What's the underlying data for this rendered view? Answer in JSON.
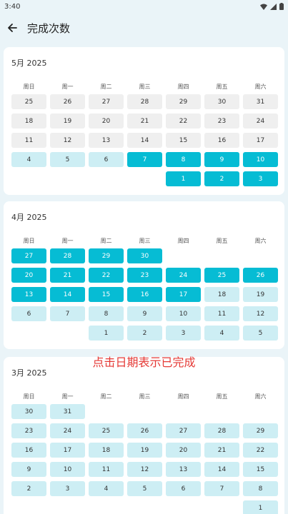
{
  "status": {
    "time": "3:40"
  },
  "app_bar": {
    "title": "完成次数"
  },
  "weekdays": [
    "周日",
    "周一",
    "周二",
    "周三",
    "周四",
    "周五",
    "周六"
  ],
  "months": [
    {
      "title": "5月 2025",
      "rows": [
        [
          {
            "d": "25",
            "s": "past"
          },
          {
            "d": "26",
            "s": "past"
          },
          {
            "d": "27",
            "s": "past"
          },
          {
            "d": "28",
            "s": "past"
          },
          {
            "d": "29",
            "s": "past"
          },
          {
            "d": "30",
            "s": "past"
          },
          {
            "d": "31",
            "s": "past"
          }
        ],
        [
          {
            "d": "18",
            "s": "past"
          },
          {
            "d": "19",
            "s": "past"
          },
          {
            "d": "20",
            "s": "past"
          },
          {
            "d": "21",
            "s": "past"
          },
          {
            "d": "22",
            "s": "past"
          },
          {
            "d": "23",
            "s": "past"
          },
          {
            "d": "24",
            "s": "past"
          }
        ],
        [
          {
            "d": "11",
            "s": "past"
          },
          {
            "d": "12",
            "s": "past"
          },
          {
            "d": "13",
            "s": "past"
          },
          {
            "d": "14",
            "s": "past"
          },
          {
            "d": "15",
            "s": "past"
          },
          {
            "d": "16",
            "s": "past"
          },
          {
            "d": "17",
            "s": "past"
          }
        ],
        [
          {
            "d": "4",
            "s": "future"
          },
          {
            "d": "5",
            "s": "future"
          },
          {
            "d": "6",
            "s": "future"
          },
          {
            "d": "7",
            "s": "done"
          },
          {
            "d": "8",
            "s": "done"
          },
          {
            "d": "9",
            "s": "done"
          },
          {
            "d": "10",
            "s": "done"
          }
        ],
        [
          null,
          null,
          null,
          null,
          {
            "d": "1",
            "s": "done"
          },
          {
            "d": "2",
            "s": "done"
          },
          {
            "d": "3",
            "s": "done"
          }
        ]
      ]
    },
    {
      "title": "4月 2025",
      "rows": [
        [
          {
            "d": "27",
            "s": "done"
          },
          {
            "d": "28",
            "s": "done"
          },
          {
            "d": "29",
            "s": "done"
          },
          {
            "d": "30",
            "s": "done"
          },
          null,
          null,
          null
        ],
        [
          {
            "d": "20",
            "s": "done"
          },
          {
            "d": "21",
            "s": "done"
          },
          {
            "d": "22",
            "s": "done"
          },
          {
            "d": "23",
            "s": "done"
          },
          {
            "d": "24",
            "s": "done"
          },
          {
            "d": "25",
            "s": "done"
          },
          {
            "d": "26",
            "s": "done"
          }
        ],
        [
          {
            "d": "13",
            "s": "done"
          },
          {
            "d": "14",
            "s": "done"
          },
          {
            "d": "15",
            "s": "done"
          },
          {
            "d": "16",
            "s": "done"
          },
          {
            "d": "17",
            "s": "done"
          },
          {
            "d": "18",
            "s": "future"
          },
          {
            "d": "19",
            "s": "future"
          }
        ],
        [
          {
            "d": "6",
            "s": "future"
          },
          {
            "d": "7",
            "s": "future"
          },
          {
            "d": "8",
            "s": "future"
          },
          {
            "d": "9",
            "s": "future"
          },
          {
            "d": "10",
            "s": "future"
          },
          {
            "d": "11",
            "s": "future"
          },
          {
            "d": "12",
            "s": "future"
          }
        ],
        [
          null,
          null,
          {
            "d": "1",
            "s": "future"
          },
          {
            "d": "2",
            "s": "future"
          },
          {
            "d": "3",
            "s": "future"
          },
          {
            "d": "4",
            "s": "future"
          },
          {
            "d": "5",
            "s": "future"
          }
        ]
      ]
    },
    {
      "title": "3月 2025",
      "rows": [
        [
          {
            "d": "30",
            "s": "future"
          },
          {
            "d": "31",
            "s": "future"
          },
          null,
          null,
          null,
          null,
          null
        ],
        [
          {
            "d": "23",
            "s": "future"
          },
          {
            "d": "24",
            "s": "future"
          },
          {
            "d": "25",
            "s": "future"
          },
          {
            "d": "26",
            "s": "future"
          },
          {
            "d": "27",
            "s": "future"
          },
          {
            "d": "28",
            "s": "future"
          },
          {
            "d": "29",
            "s": "future"
          }
        ],
        [
          {
            "d": "16",
            "s": "future"
          },
          {
            "d": "17",
            "s": "future"
          },
          {
            "d": "18",
            "s": "future"
          },
          {
            "d": "19",
            "s": "future"
          },
          {
            "d": "20",
            "s": "future"
          },
          {
            "d": "21",
            "s": "future"
          },
          {
            "d": "22",
            "s": "future"
          }
        ],
        [
          {
            "d": "9",
            "s": "future"
          },
          {
            "d": "10",
            "s": "future"
          },
          {
            "d": "11",
            "s": "future"
          },
          {
            "d": "12",
            "s": "future"
          },
          {
            "d": "13",
            "s": "future"
          },
          {
            "d": "14",
            "s": "future"
          },
          {
            "d": "15",
            "s": "future"
          }
        ],
        [
          {
            "d": "2",
            "s": "future"
          },
          {
            "d": "3",
            "s": "future"
          },
          {
            "d": "4",
            "s": "future"
          },
          {
            "d": "5",
            "s": "future"
          },
          {
            "d": "6",
            "s": "future"
          },
          {
            "d": "7",
            "s": "future"
          },
          {
            "d": "8",
            "s": "future"
          }
        ],
        [
          null,
          null,
          null,
          null,
          null,
          null,
          {
            "d": "1",
            "s": "future"
          }
        ]
      ]
    }
  ],
  "overlay": {
    "text": "点击日期表示已完成"
  },
  "colors": {
    "done": "#06bcd4",
    "future": "#cdeef4",
    "past": "#efefef",
    "overlay": "#e53935"
  },
  "icons": {
    "back": "arrow-left-icon",
    "wifi": "wifi-icon",
    "signal": "signal-icon",
    "battery": "battery-icon"
  }
}
